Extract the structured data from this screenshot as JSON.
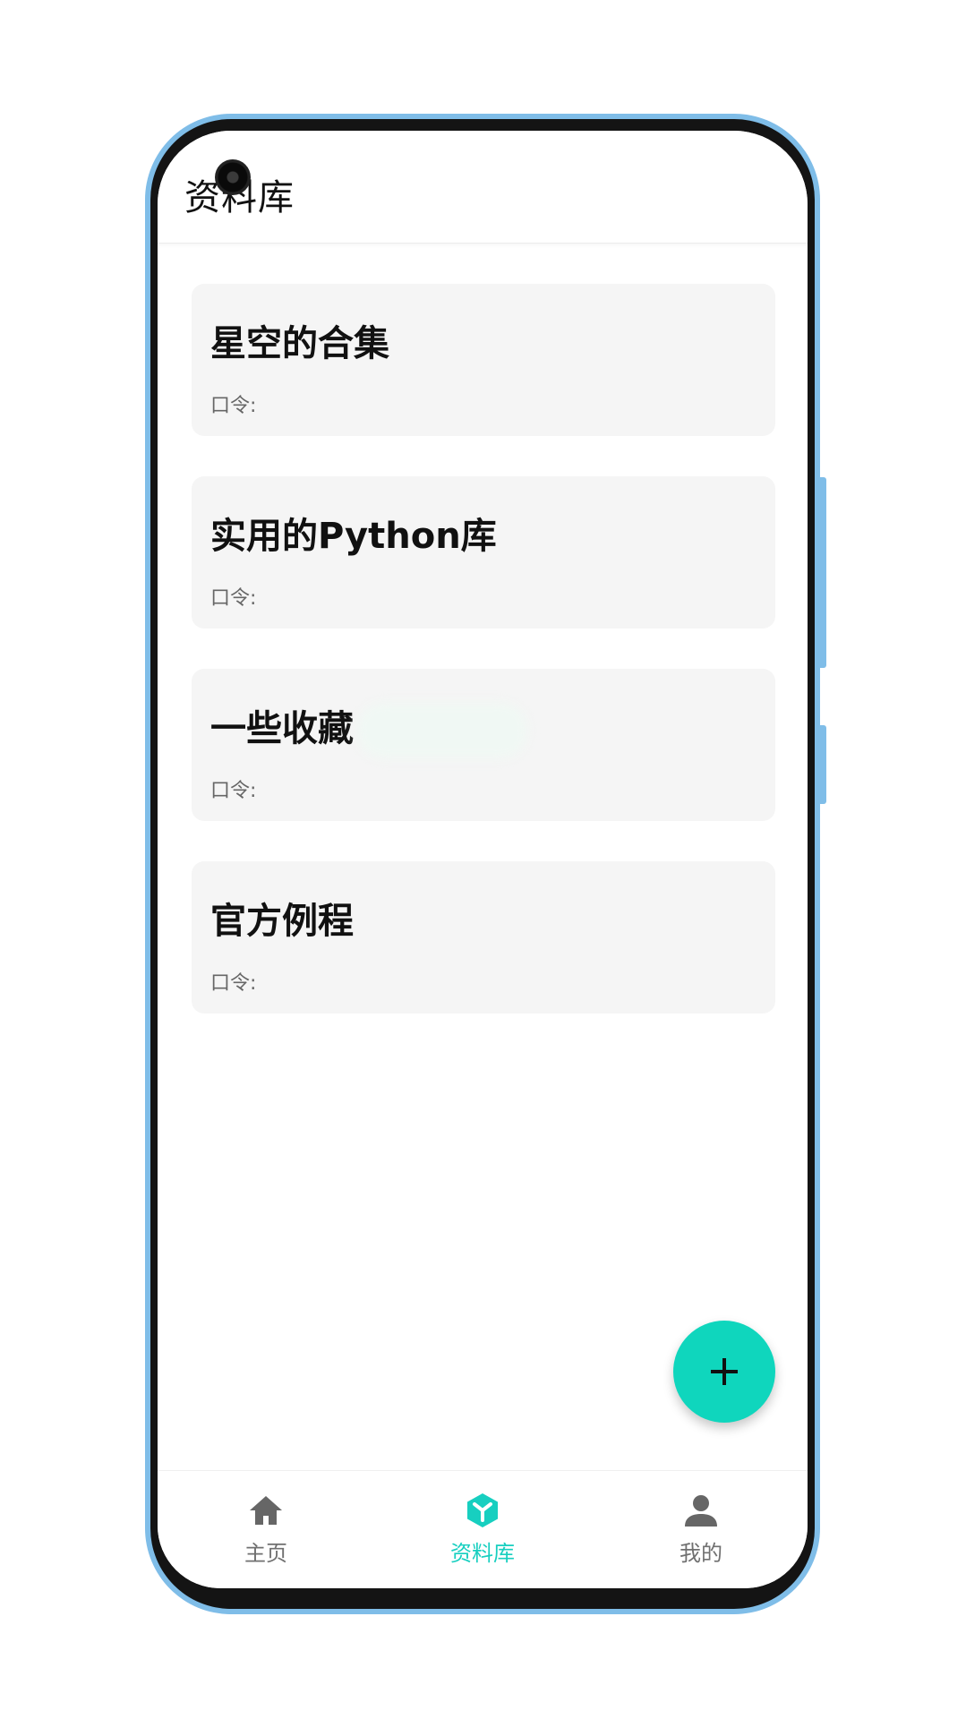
{
  "header": {
    "title": "资料库"
  },
  "cards": [
    {
      "title": "星空的合集",
      "password_label": "口令:"
    },
    {
      "title": "实用的Python库",
      "password_label": "口令:"
    },
    {
      "title": "一些收藏",
      "password_label": "口令:"
    },
    {
      "title": "官方例程",
      "password_label": "口令:"
    }
  ],
  "fab": {
    "icon": "plus-icon",
    "color": "#0fd6bd"
  },
  "bottom_nav": {
    "items": [
      {
        "label": "主页",
        "icon": "home-icon",
        "active": false
      },
      {
        "label": "资料库",
        "icon": "cube-icon",
        "active": true
      },
      {
        "label": "我的",
        "icon": "person-icon",
        "active": false
      }
    ],
    "active_color": "#17cfc0",
    "inactive_color": "#707070"
  }
}
